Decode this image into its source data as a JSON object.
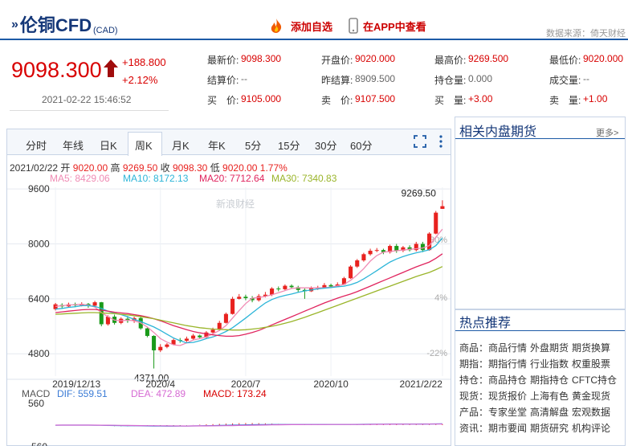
{
  "header": {
    "title": "伦铜CFD",
    "currency": "(CAD)",
    "add_watchlist": "添加自选",
    "view_in_app": "在APP中查看",
    "data_source": "数据来源：倚天财经"
  },
  "quote": {
    "price": "9098.300",
    "change": "+188.800",
    "change_pct": "+2.12%",
    "datetime": "2021-02-22 15:46:52",
    "fields": [
      {
        "label": "最新价:",
        "value": "9098.300",
        "tone": "red"
      },
      {
        "label": "开盘价:",
        "value": "9020.000",
        "tone": "red"
      },
      {
        "label": "最高价:",
        "value": "9269.500",
        "tone": "red"
      },
      {
        "label": "最低价:",
        "value": "9020.000",
        "tone": "red"
      },
      {
        "label": "结算价:",
        "value": "--",
        "tone": "grey"
      },
      {
        "label": "昨结算:",
        "value": "8909.500",
        "tone": "grey"
      },
      {
        "label": "持仓量:",
        "value": "0.000",
        "tone": "grey"
      },
      {
        "label": "成交量:",
        "value": "--",
        "tone": "grey"
      },
      {
        "label": "买　价:",
        "value": "9105.000",
        "tone": "red"
      },
      {
        "label": "卖　价:",
        "value": "9107.500",
        "tone": "red"
      },
      {
        "label": "买　量:",
        "value": "+3.00",
        "tone": "red"
      },
      {
        "label": "卖　量:",
        "value": "+1.00",
        "tone": "red"
      }
    ]
  },
  "tabs": [
    "分时",
    "年线",
    "日K",
    "周K",
    "月K",
    "年K",
    "5分",
    "15分",
    "30分",
    "60分"
  ],
  "active_tab": "周K",
  "kline_info": {
    "date": "2021/02/22",
    "open_label": "开",
    "open": "9020.00",
    "high_label": "高",
    "high": "9269.50",
    "close_label": "收",
    "close": "9098.30",
    "low_label": "低",
    "low": "9020.00",
    "pct": "1.77%",
    "ma5": "MA5: 8429.06",
    "ma10": "MA10: 8172.13",
    "ma20": "MA20: 7712.64",
    "ma30": "MA30: 7340.83"
  },
  "chart_labels": {
    "max_label": "9269.50",
    "min_label": "4371.00",
    "watermark": "新浪财经",
    "pct_right": [
      "30%",
      "4%",
      "-22%"
    ],
    "macd_title": "MACD",
    "dif": "DIF: 559.51",
    "dea": "DEA: 472.89",
    "macd": "MACD: 173.24",
    "macd_y": [
      "560",
      "-560"
    ]
  },
  "chart_data": {
    "type": "candlestick",
    "y_ticks": [
      9600,
      8000,
      6400,
      4800
    ],
    "ylim": [
      4150,
      9650
    ],
    "x_ticks": [
      "2019/12/13",
      "2020/4",
      "2020/7",
      "2020/10",
      "2021/2/22"
    ],
    "candles": [
      [
        6100,
        6240,
        6060,
        6280
      ],
      [
        6220,
        6180,
        6120,
        6270
      ],
      [
        6180,
        6240,
        6150,
        6290
      ],
      [
        6240,
        6210,
        6160,
        6290
      ],
      [
        6210,
        6250,
        6180,
        6300
      ],
      [
        6250,
        6200,
        6140,
        6280
      ],
      [
        6200,
        6300,
        6150,
        6340
      ],
      [
        6300,
        5660,
        5600,
        6310
      ],
      [
        5660,
        5880,
        5620,
        5920
      ],
      [
        5880,
        5700,
        5650,
        5940
      ],
      [
        5700,
        5820,
        5660,
        5860
      ],
      [
        5820,
        5760,
        5700,
        5900
      ],
      [
        5760,
        5840,
        5700,
        5880
      ],
      [
        5840,
        5540,
        5500,
        5880
      ],
      [
        5540,
        5320,
        5280,
        5560
      ],
      [
        5320,
        4900,
        4371,
        5340
      ],
      [
        4900,
        5000,
        4850,
        5080
      ],
      [
        5000,
        5070,
        4960,
        5110
      ],
      [
        5070,
        5200,
        5050,
        5240
      ],
      [
        5200,
        5180,
        5120,
        5260
      ],
      [
        5180,
        5240,
        5140,
        5300
      ],
      [
        5240,
        5330,
        5200,
        5380
      ],
      [
        5330,
        5280,
        5240,
        5360
      ],
      [
        5280,
        5420,
        5250,
        5460
      ],
      [
        5420,
        5500,
        5380,
        5560
      ],
      [
        5500,
        5700,
        5460,
        5760
      ],
      [
        5700,
        5960,
        5680,
        6000
      ],
      [
        5960,
        6400,
        5940,
        6460
      ],
      [
        6400,
        6460,
        6380,
        6540
      ],
      [
        6460,
        6420,
        6360,
        6520
      ],
      [
        6420,
        6360,
        6300,
        6480
      ],
      [
        6360,
        6480,
        6320,
        6540
      ],
      [
        6480,
        6520,
        6440,
        6600
      ],
      [
        6520,
        6700,
        6480,
        6740
      ],
      [
        6700,
        6680,
        6620,
        6760
      ],
      [
        6680,
        6780,
        6640,
        6820
      ],
      [
        6780,
        6740,
        6700,
        6820
      ],
      [
        6740,
        6660,
        6580,
        6780
      ],
      [
        6660,
        6620,
        6400,
        6700
      ],
      [
        6620,
        6720,
        6600,
        6760
      ],
      [
        6720,
        6720,
        6660,
        6780
      ],
      [
        6720,
        6800,
        6700,
        6860
      ],
      [
        6800,
        6760,
        6720,
        6840
      ],
      [
        6760,
        6820,
        6740,
        6880
      ],
      [
        6820,
        7000,
        6800,
        7040
      ],
      [
        7000,
        7340,
        6980,
        7380
      ],
      [
        7340,
        7520,
        7300,
        7560
      ],
      [
        7520,
        7700,
        7480,
        7740
      ],
      [
        7700,
        7800,
        7660,
        7860
      ],
      [
        7800,
        7820,
        7760,
        7880
      ],
      [
        7820,
        7760,
        7700,
        7860
      ],
      [
        7760,
        7940,
        7720,
        7980
      ],
      [
        7940,
        7800,
        7740,
        8000
      ],
      [
        7800,
        7900,
        7760,
        7940
      ],
      [
        7900,
        7820,
        7780,
        7960
      ],
      [
        7820,
        8000,
        7780,
        8060
      ],
      [
        8000,
        7820,
        7760,
        8060
      ],
      [
        7820,
        8300,
        7800,
        8340
      ],
      [
        8300,
        8909.5,
        8280,
        8960
      ],
      [
        9020,
        9098.3,
        9020,
        9269.5
      ]
    ],
    "ma_series": [
      {
        "name": "MA5",
        "color": "#f08bb4",
        "values": [
          6180,
          6200,
          6220,
          6230,
          6240,
          6220,
          6160,
          6000,
          5880,
          5780,
          5760,
          5780,
          5760,
          5700,
          5580,
          5420,
          5240,
          5140,
          5060,
          5040,
          5120,
          5200,
          5240,
          5290,
          5380,
          5480,
          5620,
          5840,
          6060,
          6260,
          6420,
          6440,
          6470,
          6520,
          6580,
          6640,
          6700,
          6720,
          6720,
          6720,
          6720,
          6720,
          6740,
          6780,
          6820,
          6940,
          7100,
          7280,
          7500,
          7660,
          7760,
          7780,
          7800,
          7820,
          7840,
          7860,
          7880,
          7950,
          8200,
          8429
        ]
      },
      {
        "name": "MA10",
        "color": "#2cb5d8",
        "values": [
          6100,
          6120,
          6150,
          6170,
          6200,
          6200,
          6180,
          6120,
          6040,
          5980,
          5940,
          5880,
          5800,
          5740,
          5660,
          5580,
          5480,
          5370,
          5260,
          5180,
          5120,
          5130,
          5180,
          5240,
          5290,
          5360,
          5450,
          5560,
          5700,
          5840,
          5990,
          6140,
          6280,
          6380,
          6450,
          6500,
          6540,
          6590,
          6630,
          6660,
          6690,
          6710,
          6730,
          6750,
          6770,
          6810,
          6880,
          6980,
          7100,
          7220,
          7350,
          7470,
          7560,
          7630,
          7690,
          7740,
          7780,
          7830,
          7950,
          8172
        ]
      },
      {
        "name": "MA20",
        "color": "#e0245e",
        "values": [
          6000,
          6020,
          6040,
          6060,
          6080,
          6090,
          6090,
          6070,
          6040,
          6010,
          5990,
          5970,
          5940,
          5910,
          5870,
          5820,
          5760,
          5690,
          5620,
          5560,
          5500,
          5450,
          5410,
          5380,
          5350,
          5330,
          5310,
          5310,
          5330,
          5370,
          5420,
          5480,
          5560,
          5640,
          5720,
          5800,
          5880,
          5960,
          6040,
          6120,
          6200,
          6280,
          6350,
          6420,
          6480,
          6540,
          6610,
          6690,
          6770,
          6850,
          6930,
          7010,
          7090,
          7170,
          7250,
          7330,
          7400,
          7470,
          7580,
          7712
        ]
      },
      {
        "name": "MA30",
        "color": "#9ab52a",
        "values": [
          5950,
          5960,
          5970,
          5980,
          5990,
          6000,
          6000,
          5990,
          5980,
          5970,
          5950,
          5930,
          5910,
          5880,
          5850,
          5820,
          5780,
          5740,
          5700,
          5660,
          5620,
          5590,
          5560,
          5540,
          5520,
          5510,
          5500,
          5490,
          5490,
          5500,
          5520,
          5540,
          5570,
          5600,
          5640,
          5690,
          5740,
          5800,
          5860,
          5930,
          6000,
          6070,
          6140,
          6210,
          6280,
          6350,
          6420,
          6490,
          6560,
          6630,
          6700,
          6770,
          6840,
          6910,
          6980,
          7050,
          7110,
          7170,
          7250,
          7340
        ]
      }
    ],
    "macd": {
      "dif": [
        -20,
        -15,
        -10,
        -5,
        0,
        -5,
        -20,
        -80,
        -140,
        -190,
        -230,
        -260,
        -280,
        -300,
        -330,
        -370,
        -420,
        -440,
        -440,
        -420,
        -390,
        -350,
        -300,
        -250,
        -200,
        -140,
        -80,
        -10,
        60,
        120,
        170,
        210,
        240,
        260,
        270,
        280,
        285,
        285,
        280,
        275,
        270,
        265,
        262,
        262,
        265,
        280,
        310,
        345,
        380,
        410,
        430,
        440,
        445,
        450,
        452,
        460,
        470,
        480,
        510,
        559
      ],
      "dea": [
        -10,
        -10,
        -10,
        -10,
        -8,
        -8,
        -10,
        -25,
        -50,
        -80,
        -110,
        -140,
        -170,
        -200,
        -225,
        -255,
        -290,
        -320,
        -345,
        -360,
        -365,
        -360,
        -350,
        -330,
        -305,
        -275,
        -240,
        -200,
        -150,
        -100,
        -50,
        0,
        50,
        100,
        140,
        175,
        200,
        220,
        235,
        245,
        252,
        257,
        260,
        262,
        263,
        267,
        275,
        290,
        310,
        330,
        350,
        370,
        385,
        400,
        412,
        422,
        432,
        442,
        455,
        473
      ],
      "hist": [
        -20,
        -10,
        0,
        10,
        16,
        6,
        -20,
        -110,
        -180,
        -220,
        -240,
        -240,
        -220,
        -200,
        -210,
        -230,
        -260,
        -240,
        -190,
        -120,
        -50,
        20,
        100,
        160,
        210,
        270,
        320,
        380,
        420,
        440,
        440,
        420,
        380,
        320,
        260,
        210,
        170,
        130,
        90,
        60,
        36,
        16,
        4,
        0,
        4,
        26,
        70,
        110,
        140,
        160,
        160,
        140,
        120,
        100,
        80,
        76,
        76,
        76,
        110,
        173
      ]
    }
  },
  "sidebar": {
    "related_title": "相关内盘期货",
    "more": "更多>",
    "hot_title": "热点推荐",
    "hot_rows": [
      {
        "cat": "商品：",
        "items": [
          "商品行情",
          "外盘期货",
          "期货换算"
        ]
      },
      {
        "cat": "期指：",
        "items": [
          "期指行情",
          "行业指数",
          "权重股票"
        ]
      },
      {
        "cat": "持仓：",
        "items": [
          "商品持仓",
          "期指持仓",
          "CFTC持仓"
        ]
      },
      {
        "cat": "现货：",
        "items": [
          "现货报价",
          "上海有色",
          "黄金现货"
        ]
      },
      {
        "cat": "产品：",
        "items": [
          "专家坐堂",
          "高清解盘",
          "宏观数据"
        ]
      },
      {
        "cat": "资讯：",
        "items": [
          "期市要闻",
          "期货研究",
          "机构评论"
        ]
      }
    ]
  },
  "colors": {
    "up": "#e8221f",
    "down": "#1a9a1a",
    "brand": "#143778"
  }
}
